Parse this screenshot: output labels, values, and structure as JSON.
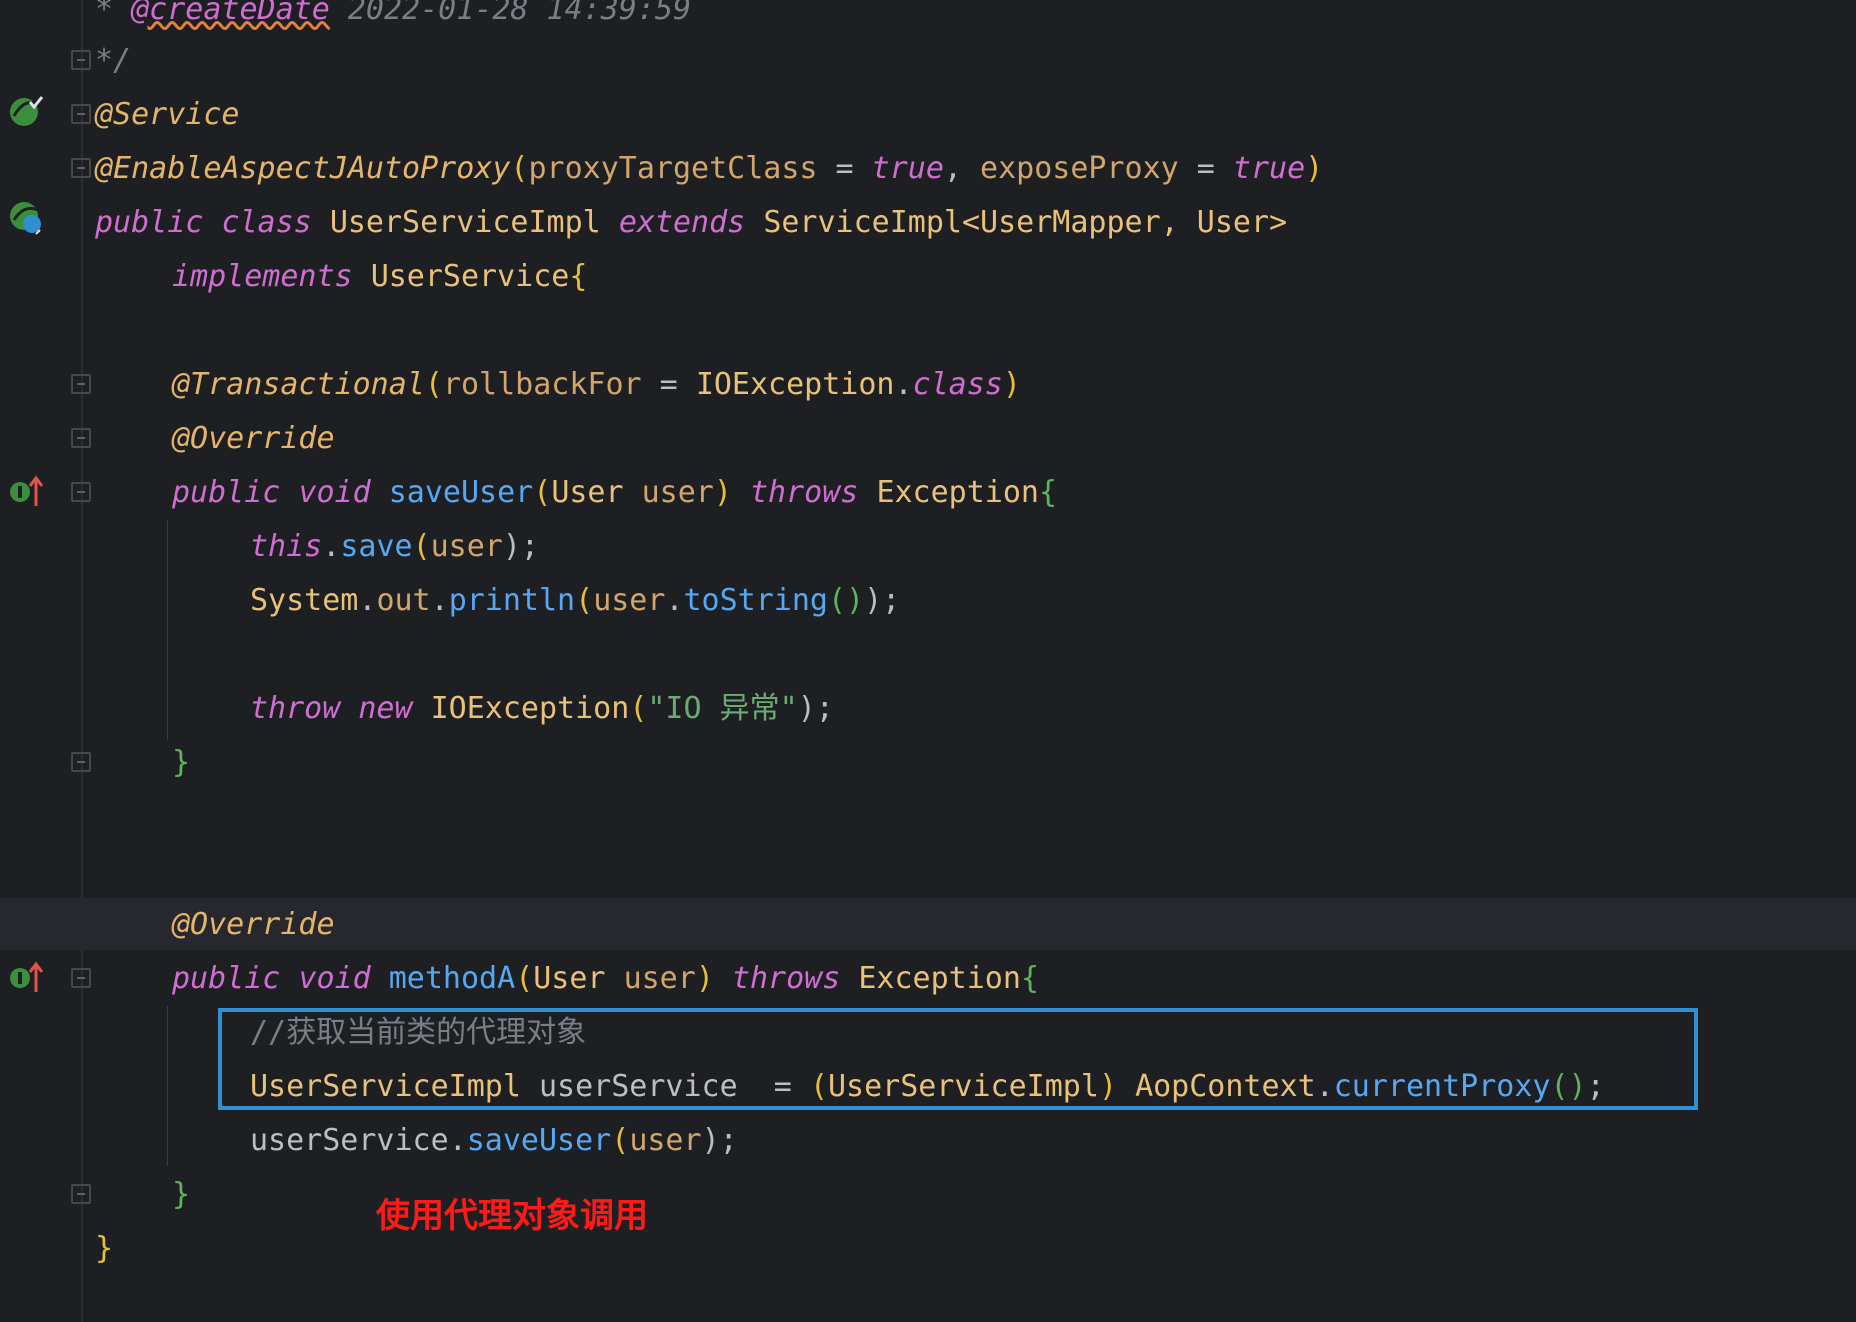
{
  "lines": {
    "l0": {
      "star": "* ",
      "tag": "@createDate",
      "date": " 2022-01-28 14:39:59"
    },
    "l1": "*/",
    "l2": "@Service",
    "l3": {
      "ann": "@EnableAspectJAutoProxy",
      "p1": "proxyTargetClass",
      "eq1": " = ",
      "v1": "true",
      "comma": ", ",
      "p2": "exposeProxy",
      "eq2": " = ",
      "v2": "true",
      "close": ")",
      "open": "("
    },
    "l4": {
      "public": "public",
      "class": "class",
      "name": "UserServiceImpl",
      "extends": "extends",
      "parent": "ServiceImpl<UserMapper, User>"
    },
    "l5": {
      "implements": "implements",
      "iface": "UserService",
      "brace": "{"
    },
    "l7": {
      "ann": "@Transactional",
      "open": "(",
      "param": "rollbackFor",
      "eq": " = ",
      "cls": "IOException",
      "dot": ".",
      "kw": "class",
      "close": ")"
    },
    "l8": "@Override",
    "l9": {
      "public": "public",
      "void": "void",
      "name": "saveUser",
      "open": "(",
      "type": "User",
      "param": "user",
      "close": ")",
      "throws": "throws",
      "exc": "Exception",
      "brace": "{"
    },
    "l10": {
      "this": "this",
      "dot": ".",
      "fn": "save",
      "open": "(",
      "arg": "user",
      "close": ");"
    },
    "l11": {
      "sys": "System",
      "dot1": ".",
      "out": "out",
      "dot2": ".",
      "fn": "println",
      "open": "(",
      "arg": "user",
      "dot3": ".",
      "fn2": "toString",
      "paren": "()",
      "close": ");"
    },
    "l13": {
      "throw": "throw",
      "new": "new",
      "cls": "IOException",
      "open": "(",
      "str": "\"IO 异常\"",
      "close": ");"
    },
    "l14": "}",
    "l17": "@Override",
    "l18": {
      "public": "public",
      "void": "void",
      "name": "methodA",
      "open": "(",
      "type": "User",
      "param": "user",
      "close": ")",
      "throws": "throws",
      "exc": "Exception",
      "brace": "{"
    },
    "l19": "//获取当前类的代理对象",
    "l20": {
      "type": "UserServiceImpl",
      "var": "userService",
      "eq": "  = ",
      "cast_open": "(",
      "cast": "UserServiceImpl",
      "cast_close": ")",
      "ctx": "AopContext",
      "dot": ".",
      "fn": "currentProxy",
      "paren": "()",
      "semi": ";"
    },
    "l21": {
      "var": "userService",
      "dot": ".",
      "fn": "saveUser",
      "open": "(",
      "arg": "user",
      "close": ");"
    },
    "l22": "}",
    "l23": "}"
  },
  "annotation_note": "使用代理对象调用",
  "colors": {
    "highlight_box": "#2f8fd1",
    "note": "#ff1a1a",
    "background": "#1e1f22"
  },
  "gutter_icons": [
    "spring-bean-icon",
    "spring-bean-overview-icon",
    "implements-method-icon",
    "implements-method-icon"
  ]
}
